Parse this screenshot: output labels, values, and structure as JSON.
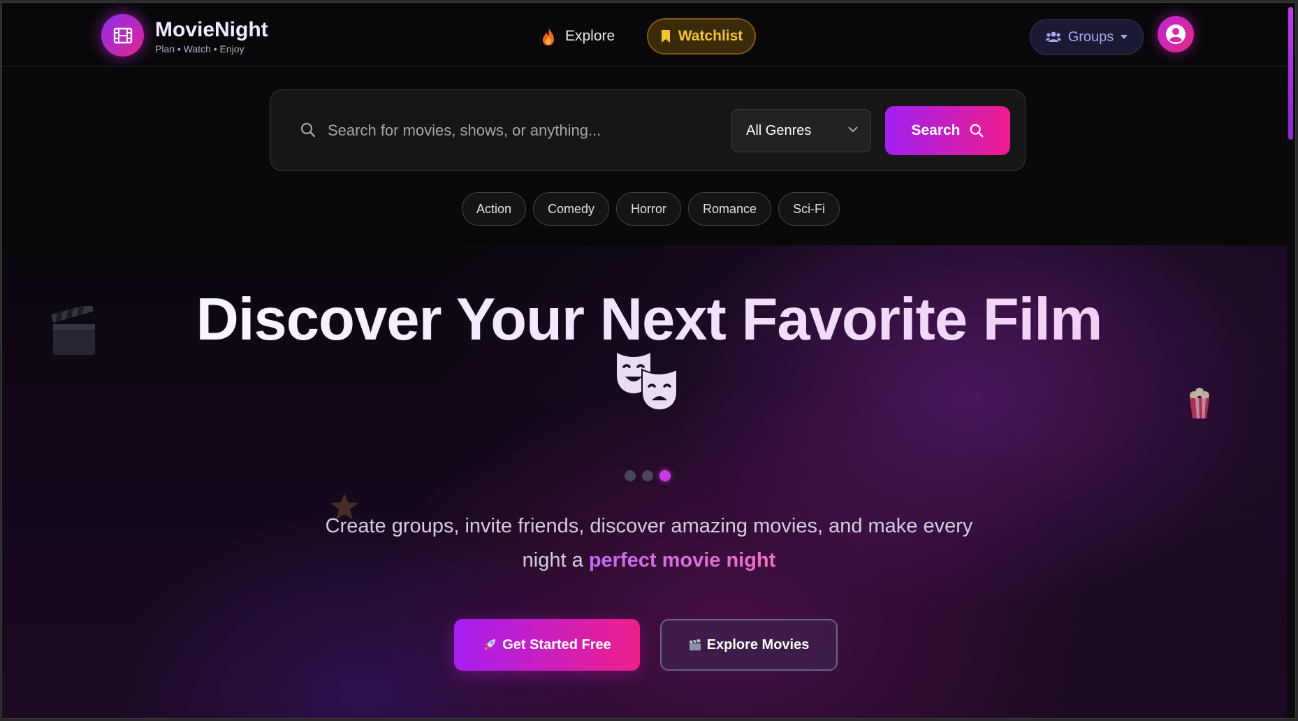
{
  "app": {
    "title": "MovieNight",
    "tagline": "Plan • Watch • Enjoy"
  },
  "nav": {
    "explore_label": "Explore",
    "watchlist_label": "Watchlist",
    "groups_label": "Groups",
    "colors": {
      "watchlist": "#f5c233",
      "groups": "#a8a8ee",
      "accent": "#c83ee0"
    }
  },
  "search": {
    "placeholder": "Search for movies, shows, or anything...",
    "genre_selected": "All Genres",
    "button_label": "Search",
    "chips": [
      "Action",
      "Comedy",
      "Horror",
      "Romance",
      "Sci-Fi"
    ]
  },
  "hero": {
    "title": "Discover Your Next Favorite Film",
    "subtitle_line1": "Create groups, invite friends, discover amazing movies, and make every",
    "subtitle_line2_prefix": "night a ",
    "subtitle_highlight": "perfect movie night",
    "slides_total": 3,
    "slide_active": 3,
    "primary_button": "Get Started Free",
    "secondary_button": "Explore Movies",
    "icons": [
      "theater-masks-icon",
      "clapperboard-icon",
      "popcorn-icon",
      "star-icon"
    ]
  }
}
